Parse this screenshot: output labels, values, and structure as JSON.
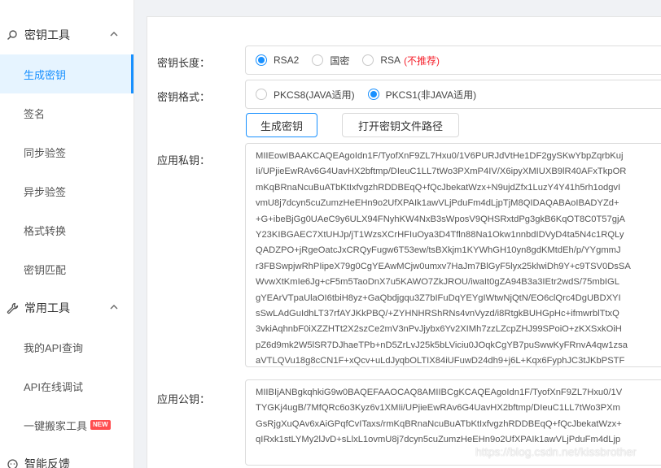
{
  "sidebar": {
    "group_key_tools": {
      "label": "密钥工具"
    },
    "key_tools_items": [
      {
        "label": "生成密钥",
        "active": true
      },
      {
        "label": "签名"
      },
      {
        "label": "同步验签"
      },
      {
        "label": "异步验签"
      },
      {
        "label": "格式转换"
      },
      {
        "label": "密钥匹配"
      }
    ],
    "group_common_tools": {
      "label": "常用工具"
    },
    "common_tools_items": [
      {
        "label": "我的API查询"
      },
      {
        "label": "API在线调试"
      },
      {
        "label": "一键搬家工具",
        "badge": "NEW"
      }
    ],
    "group_feedback": {
      "label": "智能反馈"
    }
  },
  "form": {
    "key_length": {
      "label": "密钥长度：",
      "options": [
        {
          "label": "RSA2",
          "checked": true
        },
        {
          "label": "国密",
          "checked": false
        },
        {
          "label": "RSA",
          "checked": false
        }
      ],
      "rsa_note": "(不推荐)"
    },
    "key_format": {
      "label": "密钥格式：",
      "options": [
        {
          "label": "PKCS8(JAVA适用)",
          "checked": false
        },
        {
          "label": "PKCS1(非JAVA适用)",
          "checked": true
        }
      ]
    },
    "buttons": {
      "generate": "生成密钥",
      "open_path": "打开密钥文件路径"
    },
    "private_key": {
      "label": "应用私钥：",
      "lines": [
        "MIIEowIBAAKCAQEAgoIdn1F/TyofXnF9ZL7Hxu0/1V6PURJdVtHe1DF2gySKwYbpZqrbKuj",
        "Ii/UPjieEwRAv6G4UavHX2bftmp/DIeuC1LL7tWo3PXmP4IV/X6ipyXMIUXB9lR40AFxTkpOR",
        "mKqBRnaNcuBuATbKtIxfvgzhRDDBEqQ+fQcJbekatWzx+N9ujdZfx1LuzY4Y41h5rh1odgvI",
        "vmU8j7dcyn5cuZumzHeEHn9o2UfXPAIk1awVLjPduFm4dLjpTjM8QIDAQABAoIBADYZd+",
        "+G+ibeBjGg0UAeC9y6ULX94FNyhKW4NxB3sWposV9QHSRxtdPg3gkB6KqOT8C0T57gjA",
        "Y23KIBGAEC7XtUHJp/jT1WzsXCrHFIuOya3D4Tfln88Na1Okw1nnbdIDVyD4ta5N4c1RQLy",
        "QADZPO+jRgeOatcJxCRQyFugw6T53ew/tsBXkjm1KYWhGH10yn8gdKMtdEh/p/YYgmmJ",
        "r3FBSwpjwRhPIipeX79g0CgYEAwMCjw0umxv7HaJm7BlGyF5lyx25klwiDh9Y+c9TSV0DsSA",
        "WvwXtKmIe6Jg+cF5m5TaoDnX7u5KAWO7ZkJROU/iwaIt0gZA94B3a3IEtr2wdS/75mbIGL",
        "gYEArVTpaUlaOI6tbiH8yz+GaQbdjgqu3Z7bIFuDqYEYgIWtwNjQtN/EO6clQrc4DgUBDXYI",
        "sSwLAdGuIdhLT37rfAYJKkPBQ/+ZYHNHRShRNs4vnVyzd/i8RtgkBUHGpHc+ifmwrblTtxQ",
        "3vkiAqhnbF0iXZZHTt2X2szCe2mV3nPvJjybx6Yv2XIMh7zzLZcpZHJ99SPoiO+zKXSxkOiH",
        "pZ6d9mk2W5lSR7DJhaeTPb+nD5ZrLvJ25k5bLViciu0JOqkCgYB7puSwwKyFRnvA4qw1zsa",
        "aVTLQVu18g8cCN1F+xQcv+uLdJyqbOLTIX84iUFuwD24dh9+j6L+Kqx6FyphJC3tJKbPSTF"
      ]
    },
    "public_key": {
      "label": "应用公钥：",
      "lines": [
        "MIIBIjANBgkqhkiG9w0BAQEFAAOCAQ8AMIIBCgKCAQEAgoIdn1F/TyofXnF9ZL7Hxu0/1V",
        "TYGKj4ugB/7MfQRc6o3Kyz6v1XMIi/UPjieEwRAv6G4UavHX2bftmp/DIeuC1LL7tWo3PXm",
        "GsRjgXuQAv6xAiGPqfCvITaxs/rmKqBRnaNcuBuATbKtIxfvgzhRDDBEqQ+fQcJbekatWzx+",
        "qIRxk1stLYMy2lJvD+sLlxL1ovmU8j7dcyn5cuZumzHeEHn9o2UfXPAIk1awVLjPduFm4dLjp"
      ]
    }
  },
  "watermark": "https://blog.csdn.net/kissbrother",
  "colors": {
    "accent": "#1890ff",
    "warning": "#f5222d"
  }
}
